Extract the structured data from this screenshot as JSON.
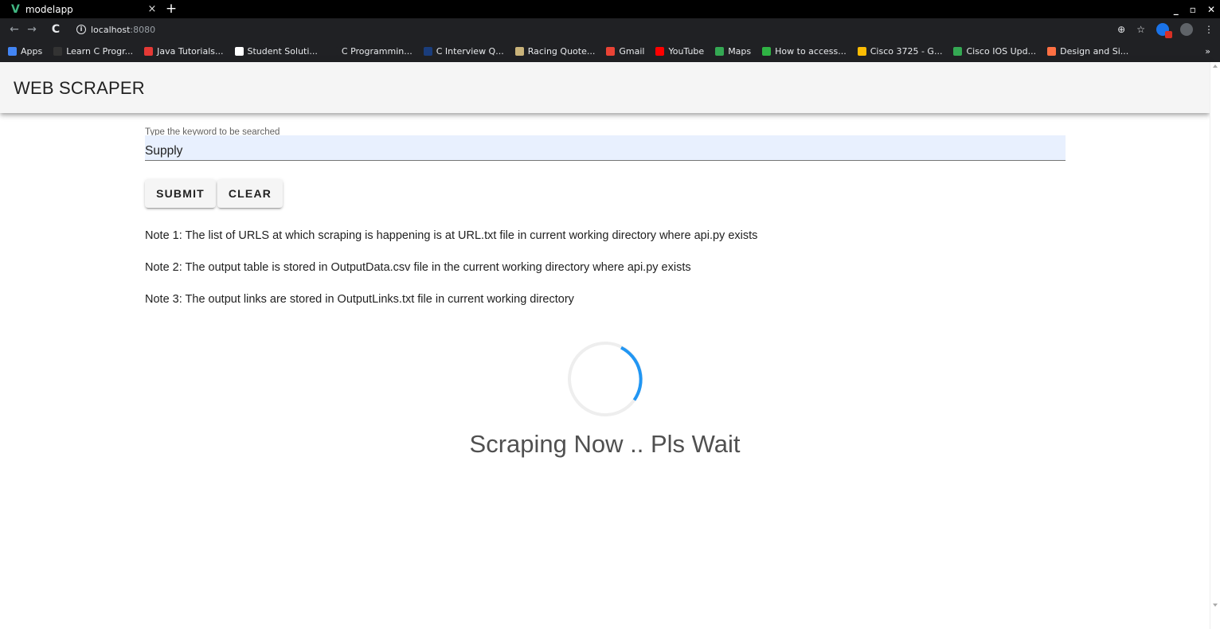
{
  "browser": {
    "tab_title": "modelapp",
    "tab_close": "×",
    "new_tab": "+",
    "window_controls": [
      "_",
      "▫",
      "✕"
    ],
    "nav": {
      "back": "←",
      "forward": "→",
      "reload": "C"
    },
    "url_host": "localhost",
    "url_port": ":8080",
    "toolbar_icons": [
      "zoom-icon",
      "star-icon",
      "extension-icon",
      "profile-icon",
      "menu-icon"
    ],
    "bookmarks": [
      {
        "label": "Apps",
        "color": "#4285f4"
      },
      {
        "label": "Learn C Progr...",
        "color": "#333333"
      },
      {
        "label": "Java Tutorials...",
        "color": "#e53935"
      },
      {
        "label": "Student Soluti...",
        "color": "#ffffff"
      },
      {
        "label": "C Programmin...",
        "color": "#202124"
      },
      {
        "label": "C Interview Q...",
        "color": "#1a3d7c"
      },
      {
        "label": "Racing Quote...",
        "color": "#c9b37a"
      },
      {
        "label": "Gmail",
        "color": "#ea4335"
      },
      {
        "label": "YouTube",
        "color": "#ff0000"
      },
      {
        "label": "Maps",
        "color": "#34a853"
      },
      {
        "label": "How to access...",
        "color": "#2fb344"
      },
      {
        "label": "Cisco 3725 - G...",
        "color": "#fbbc04"
      },
      {
        "label": "Cisco IOS Upd...",
        "color": "#34a853"
      },
      {
        "label": "Design and Si...",
        "color": "#ff7043"
      }
    ],
    "bookmarks_more": "»"
  },
  "app": {
    "title": "WEB SCRAPER",
    "bar_color": "#f5f5f5"
  },
  "search": {
    "label": "Type the keyword to be searched",
    "value": "Supply"
  },
  "buttons": {
    "submit": "SUBMIT",
    "clear": "CLEAR"
  },
  "notes": [
    "Note 1: The list of URLS at which scraping is happening is at URL.txt file in current working directory where api.py exists",
    "Note 2: The output table is stored in OutputData.csv file in the current working directory where api.py exists",
    "Note 3: The output links are stored in OutputLinks.txt file in current working directory"
  ],
  "loading": {
    "text": "Scraping Now .. Pls Wait",
    "spinner_color": "#2196f3",
    "track_color": "#eeeeee"
  }
}
